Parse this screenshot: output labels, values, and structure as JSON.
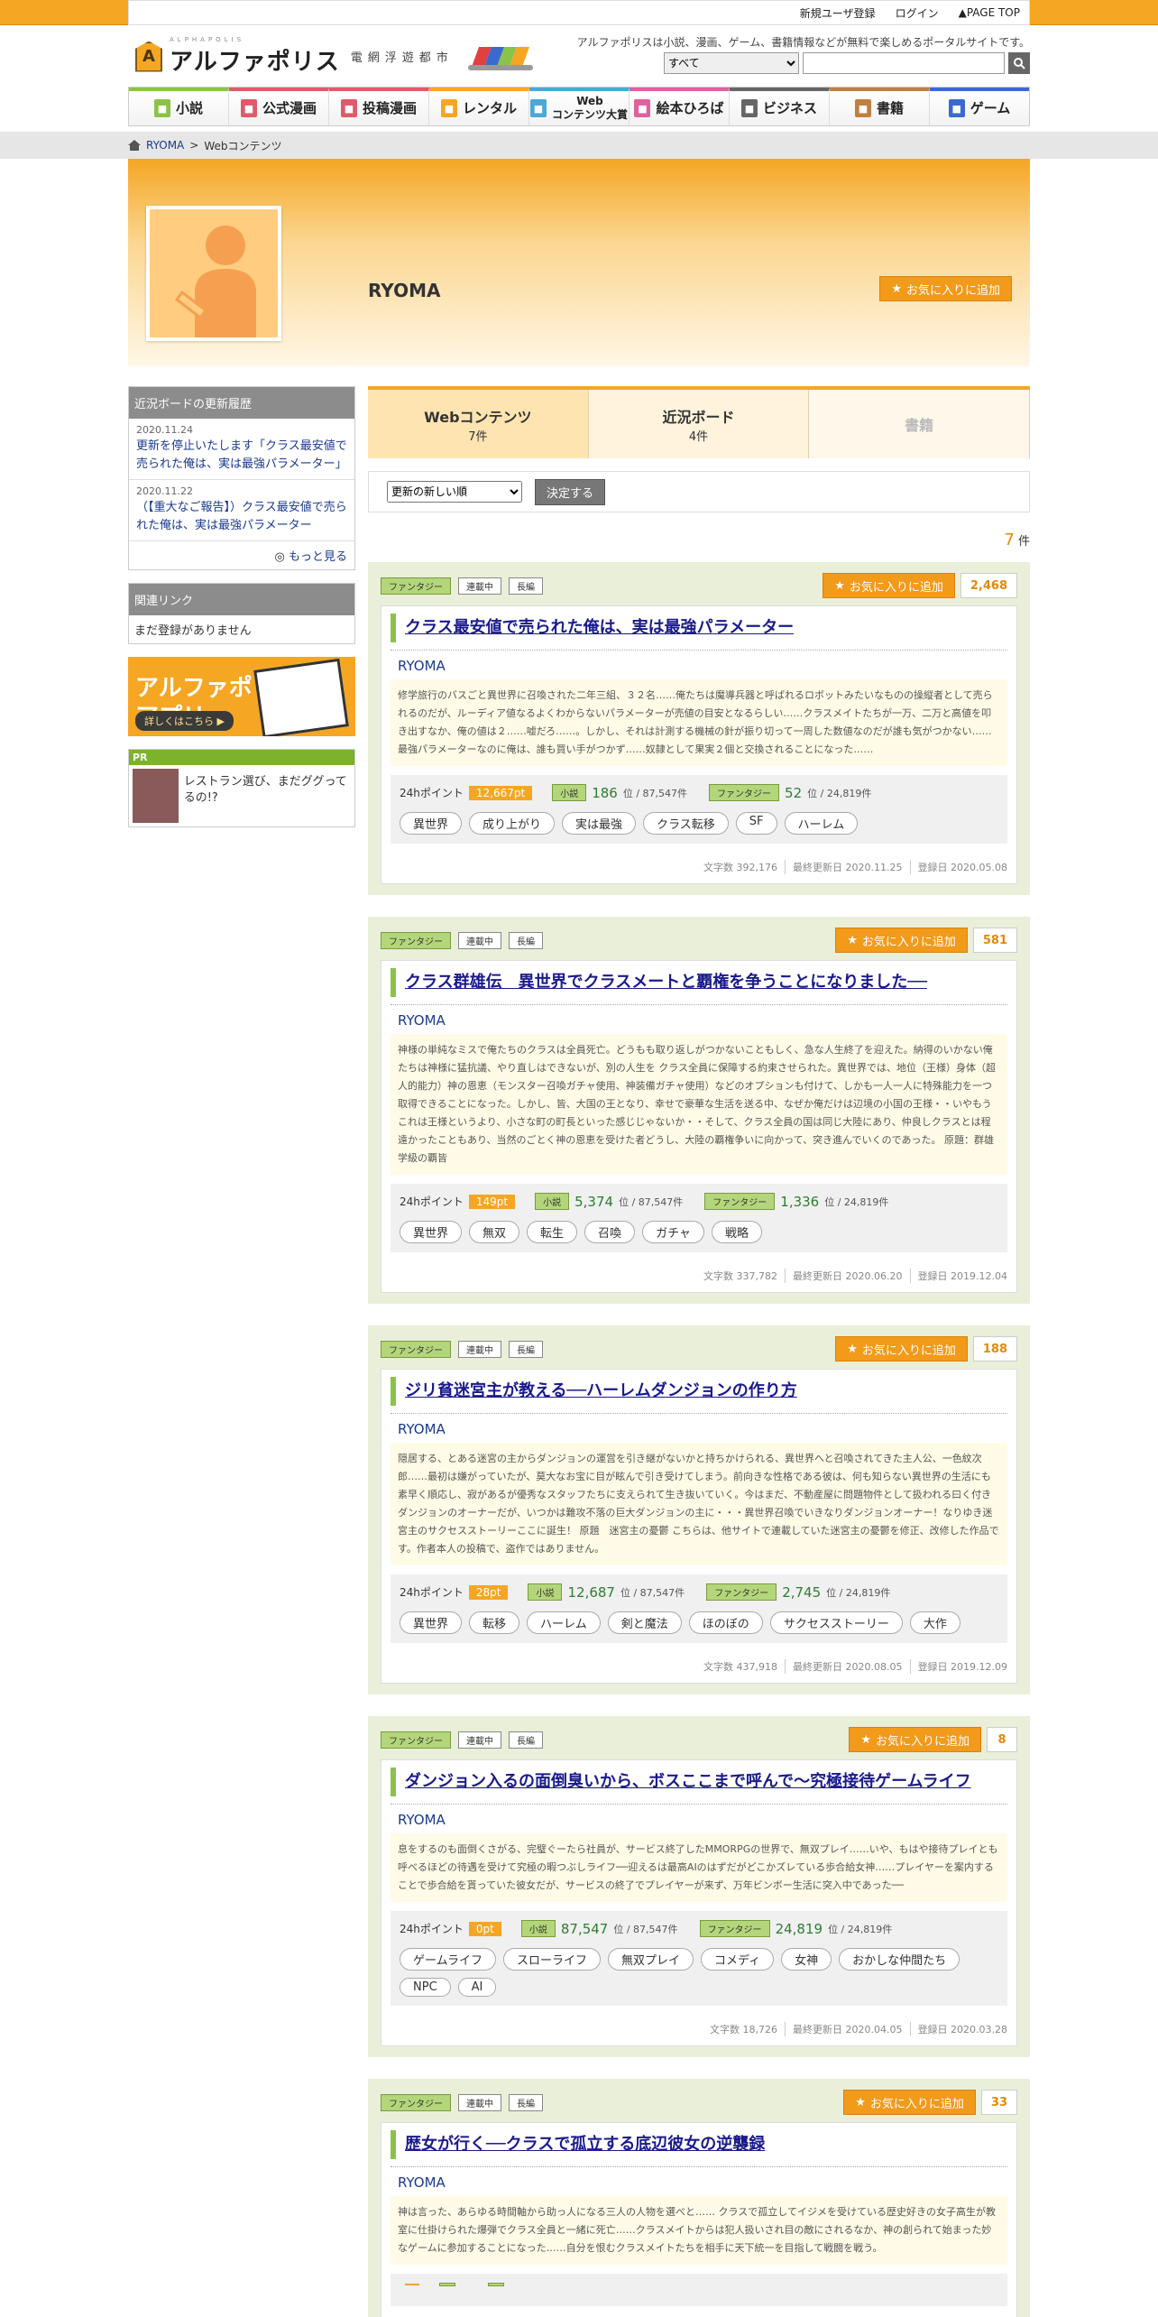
{
  "topbar": {
    "register": "新規ユーザ登録",
    "login": "ログイン",
    "pagetop": "PAGE TOP"
  },
  "header": {
    "logo": "アルファポリス",
    "logo_sub": "電網浮遊都市",
    "logo_kana": "ALPHAPOLIS",
    "tagline": "アルファポリスは小説、漫画、ゲーム、書籍情報などが無料で楽しめるポータルサイトです。",
    "search_select": "すべて",
    "search_placeholder": ""
  },
  "nav": [
    {
      "label": "小説",
      "color": "#8bc34a"
    },
    {
      "label": "公式漫画",
      "color": "#e05a6a"
    },
    {
      "label": "投稿漫画",
      "color": "#e05a6a"
    },
    {
      "label": "レンタル",
      "color": "#f5a623"
    },
    {
      "label": "Web\nコンテンツ大賞",
      "color": "#4aa8d8"
    },
    {
      "label": "絵本ひろば",
      "color": "#e060a0"
    },
    {
      "label": "ビジネス",
      "color": "#666666"
    },
    {
      "label": "書籍",
      "color": "#c08040"
    },
    {
      "label": "ゲーム",
      "color": "#3a6ad0"
    }
  ],
  "breadcrumb": {
    "item1": "RYOMA",
    "sep": ">",
    "item2": "Webコンテンツ"
  },
  "profile": {
    "name": "RYOMA",
    "fav": "お気に入りに追加"
  },
  "sidebar": {
    "history_title": "近況ボードの更新履歴",
    "history": [
      {
        "date": "2020.11.24",
        "text": "更新を停止いたします「クラス最安値で売られた俺は、実は最強パラメーター」"
      },
      {
        "date": "2020.11.22",
        "text": "（【重大なご報告】）クラス最安値で売られた俺は、実は最強パラメーター"
      }
    ],
    "more": "もっと見る",
    "links_title": "関連リンク",
    "links_none": "まだ登録がありません",
    "app_line1": "アルファポリスの",
    "app_line2": "アプリ",
    "app_btn": "詳しくはこちら ▶",
    "pr_label": "PR",
    "pr_text": "レストラン選び、まだググってるの!?"
  },
  "tabs": [
    {
      "label": "Webコンテンツ",
      "count": "7",
      "unit": "件"
    },
    {
      "label": "近況ボード",
      "count": "4",
      "unit": "件"
    },
    {
      "label": "書籍",
      "count": "",
      "unit": ""
    }
  ],
  "sort": {
    "selected": "更新の新しい順",
    "button": "決定する"
  },
  "total": {
    "count": "7",
    "unit": "件"
  },
  "cards": [
    {
      "labels": [
        "ファンタジー",
        "連載中",
        "長編"
      ],
      "fav": "お気に入りに追加",
      "favcount": "2,468",
      "title": "クラス最安値で売られた俺は、実は最強パラメーター",
      "author": "RYOMA",
      "summary": "修学旅行のバスごと異世界に召喚された二年三組、３２名……俺たちは魔導兵器と呼ばれるロボットみたいなものの操縦者として売られるのだが、ルーディア値なるよくわからないパラメーターが売値の目安となるらしい……クラスメイトたちが一万、二万と高値を叩き出すなか、俺の値は２……嘘だろ……。しかし、それは計測する機械の針が振り切って一周した数値なのだが誰も気がつかない……最強パラメーターなのに俺は、誰も買い手がつかず……奴隷として果実２個と交換されることになった……",
      "pts_label": "24hポイント",
      "pts": "12,667pt",
      "r1l": "小説",
      "r1": "186",
      "r1t": "位 / 87,547件",
      "r2l": "ファンタジー",
      "r2": "52",
      "r2t": "位 / 24,819件",
      "tags": [
        "異世界",
        "成り上がり",
        "実は最強",
        "クラス転移",
        "SF",
        "ハーレム"
      ],
      "chars": "文字数 392,176",
      "updated": "最終更新日 2020.11.25",
      "registered": "登録日 2020.05.08"
    },
    {
      "labels": [
        "ファンタジー",
        "連載中",
        "長編"
      ],
      "fav": "お気に入りに追加",
      "favcount": "581",
      "title": "クラス群雄伝　異世界でクラスメートと覇権を争うことになりました──",
      "author": "RYOMA",
      "summary": "神様の単純なミスで俺たちのクラスは全員死亡。どうもも取り返しがつかないこともしく、急な人生終了を迎えた。納得のいかない俺たちは神様に猛抗議、やり直しはできないが、別の人生を クラス全員に保障する約束させられた。異世界では、地位（王様）身体（超人的能力）神の恩恵（モンスター召喚ガチャ使用、神装備ガチャ使用）などのオプションも付けて、しかも一人一人に特殊能力を一つ取得できることになった。しかし、皆、大国の王となり、幸せで豪華な生活を送る中、なぜか俺だけは辺境の小国の王様・・いやもうこれは王様というより、小さな町の町長といった感じじゃないか・・そして、クラス全員の国は同じ大陸にあり、仲良しクラスとは程遠かったこともあり、当然のごとく神の恩恵を受けた者どうし、大陸の覇権争いに向かって、突き進んでいくのであった。 原題：群雄学級の覇皆",
      "pts_label": "24hポイント",
      "pts": "149pt",
      "r1l": "小説",
      "r1": "5,374",
      "r1t": "位 / 87,547件",
      "r2l": "ファンタジー",
      "r2": "1,336",
      "r2t": "位 / 24,819件",
      "tags": [
        "異世界",
        "無双",
        "転生",
        "召喚",
        "ガチャ",
        "戦略"
      ],
      "chars": "文字数 337,782",
      "updated": "最終更新日 2020.06.20",
      "registered": "登録日 2019.12.04"
    },
    {
      "labels": [
        "ファンタジー",
        "連載中",
        "長編"
      ],
      "fav": "お気に入りに追加",
      "favcount": "188",
      "title": "ジリ貧迷宮主が教える──ハーレムダンジョンの作り方",
      "author": "RYOMA",
      "summary": "隠居する、とある迷宮の主からダンジョンの運営を引き継がないかと持ちかけられる、異世界へと召喚されてきた主人公、一色紋次郎……最初は嫌がっていたが、莫大なお宝に目が眩んで引き受けてしまう。前向きな性格である彼は、何も知らない異世界の生活にも素早く順応し、寂があるが優秀なスタッフたちに支えられて生き抜いていく。今はまだ、不動産屋に問題物件として扱われる曰く付きダンジョンのオーナーだが、いつかは難攻不落の巨大ダンジョンの主に・・・異世界召喚でいきなりダンジョンオーナー！なりゆき迷宮主のサクセスストーリーここに誕生！ 原題　迷宮主の憂鬱 こちらは、他サイトで連載していた迷宮主の憂鬱を修正、改修した作品です。作者本人の投稿で、盗作ではありません。",
      "pts_label": "24hポイント",
      "pts": "28pt",
      "r1l": "小説",
      "r1": "12,687",
      "r1t": "位 / 87,547件",
      "r2l": "ファンタジー",
      "r2": "2,745",
      "r2t": "位 / 24,819件",
      "tags": [
        "異世界",
        "転移",
        "ハーレム",
        "剣と魔法",
        "ほのぼの",
        "サクセスストーリー",
        "大作"
      ],
      "chars": "文字数 437,918",
      "updated": "最終更新日 2020.08.05",
      "registered": "登録日 2019.12.09"
    },
    {
      "labels": [
        "ファンタジー",
        "連載中",
        "長編"
      ],
      "fav": "お気に入りに追加",
      "favcount": "8",
      "title": "ダンジョン入るの面倒臭いから、ボスここまで呼んで〜究極接待ゲームライフ",
      "author": "RYOMA",
      "summary": "息をするのも面倒くさがる、完璧ぐーたら社員が、サービス終了したMMORPGの世界で、無双プレイ……いや、もはや接待プレイとも呼べるほどの待遇を受けて究極の暇つぶしライフ──迎えるは最高AIのはずだがどこかズレている歩合給女神……プレイヤーを案内することで歩合給を貰っていた彼女だが、サービスの終了でプレイヤーが来ず、万年ビンボー生活に突入中であった──",
      "pts_label": "24hポイント",
      "pts": "0pt",
      "r1l": "小説",
      "r1": "87,547",
      "r1t": "位 / 87,547件",
      "r2l": "ファンタジー",
      "r2": "24,819",
      "r2t": "位 / 24,819件",
      "tags": [
        "ゲームライフ",
        "スローライフ",
        "無双プレイ",
        "コメディ",
        "女神",
        "おかしな仲間たち",
        "NPC",
        "AI"
      ],
      "chars": "文字数 18,726",
      "updated": "最終更新日 2020.04.05",
      "registered": "登録日 2020.03.28"
    },
    {
      "labels": [
        "ファンタジー",
        "連載中",
        "長編"
      ],
      "fav": "お気に入りに追加",
      "favcount": "33",
      "title": "歴女が行く──クラスで孤立する底辺彼女の逆襲録",
      "author": "RYOMA",
      "summary": "神は言った、あらゆる時間軸から助っ人になる三人の人物を選べと…… クラスで孤立してイジメを受けている歴史好きの女子高生が教室に仕掛けられた爆弾でクラス全員と一緒に死亡……クラスメイトからは犯人扱いされ目の敵にされるなか、神の創られて始まった妙なゲームに参加することになった……自分を恨むクラスメイトたちを相手に天下統一を目指して戦闘を戦う。",
      "pts_label": "",
      "pts": "",
      "r1l": "",
      "r1": "",
      "r1t": "",
      "r2l": "",
      "r2": "",
      "r2t": "",
      "tags": [],
      "chars": "",
      "updated": "",
      "registered": ""
    }
  ]
}
